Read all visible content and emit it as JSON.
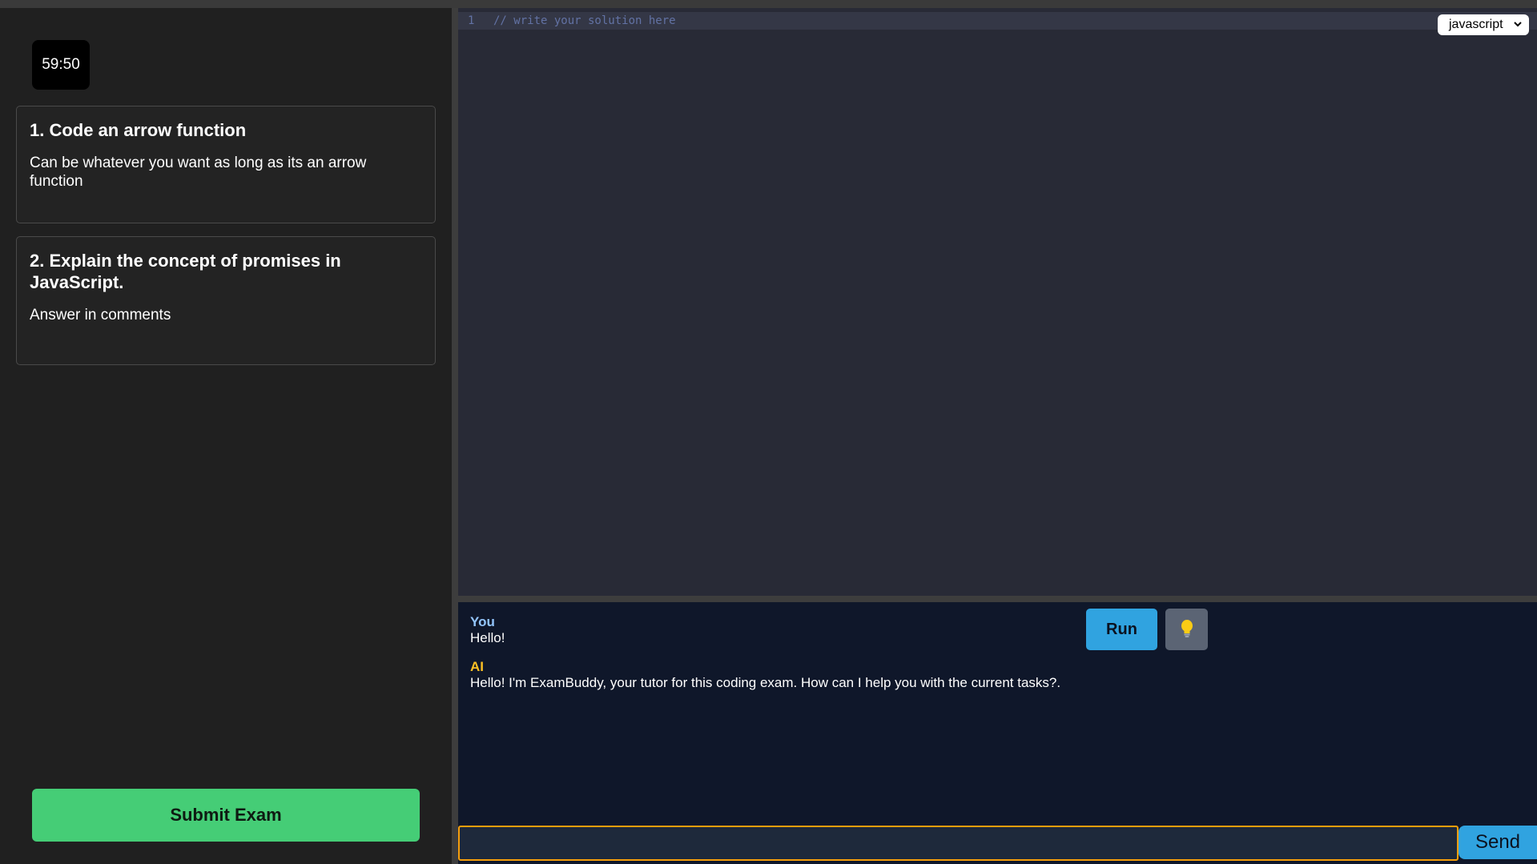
{
  "timer": {
    "value": "59:50"
  },
  "questions": [
    {
      "title": "1. Code an arrow function",
      "description": "Can be whatever you want as long as its an arrow function"
    },
    {
      "title": "2. Explain the concept of promises in JavaScript.",
      "description": "Answer in comments"
    }
  ],
  "submit": {
    "label": "Submit Exam"
  },
  "editor": {
    "line_number": "1",
    "code": "// write your solution here",
    "language": "javascript"
  },
  "chat": {
    "messages": [
      {
        "sender": "You",
        "text": "Hello!"
      },
      {
        "sender": "AI",
        "text": "Hello! I'm ExamBuddy, your tutor for this coding exam. How can I help you with the current tasks?."
      }
    ],
    "run_label": "Run",
    "hint_icon": "lightbulb-icon",
    "input_value": "",
    "input_placeholder": "",
    "send_label": "Send"
  },
  "colors": {
    "submit_green": "#45cd76",
    "accent_blue": "#30a3e0",
    "ai_sender": "#fbbf24",
    "you_sender": "#93c5fd",
    "input_border": "#f59e0b"
  }
}
